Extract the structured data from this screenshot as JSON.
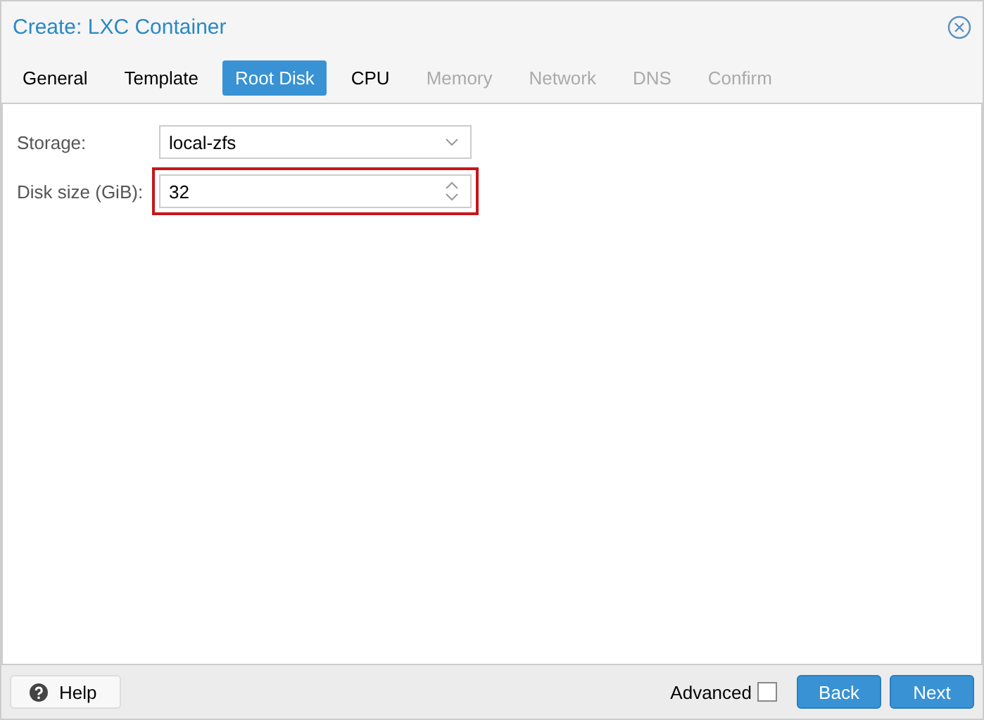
{
  "window": {
    "title": "Create: LXC Container"
  },
  "tabs": [
    {
      "label": "General",
      "selected": false,
      "disabled": false
    },
    {
      "label": "Template",
      "selected": false,
      "disabled": false
    },
    {
      "label": "Root Disk",
      "selected": true,
      "disabled": false
    },
    {
      "label": "CPU",
      "selected": false,
      "disabled": false
    },
    {
      "label": "Memory",
      "selected": false,
      "disabled": true
    },
    {
      "label": "Network",
      "selected": false,
      "disabled": true
    },
    {
      "label": "DNS",
      "selected": false,
      "disabled": true
    },
    {
      "label": "Confirm",
      "selected": false,
      "disabled": true
    }
  ],
  "fields": [
    {
      "kind": "dropdown",
      "label": "Storage:",
      "value": "local-zfs",
      "highlighted": false
    },
    {
      "kind": "spinner",
      "label": "Disk size (GiB):",
      "value": "32",
      "highlighted": true
    }
  ],
  "footer": {
    "help": "Help",
    "advanced": {
      "label": "Advanced",
      "checked": false
    },
    "buttons": [
      "Back",
      "Next"
    ]
  }
}
